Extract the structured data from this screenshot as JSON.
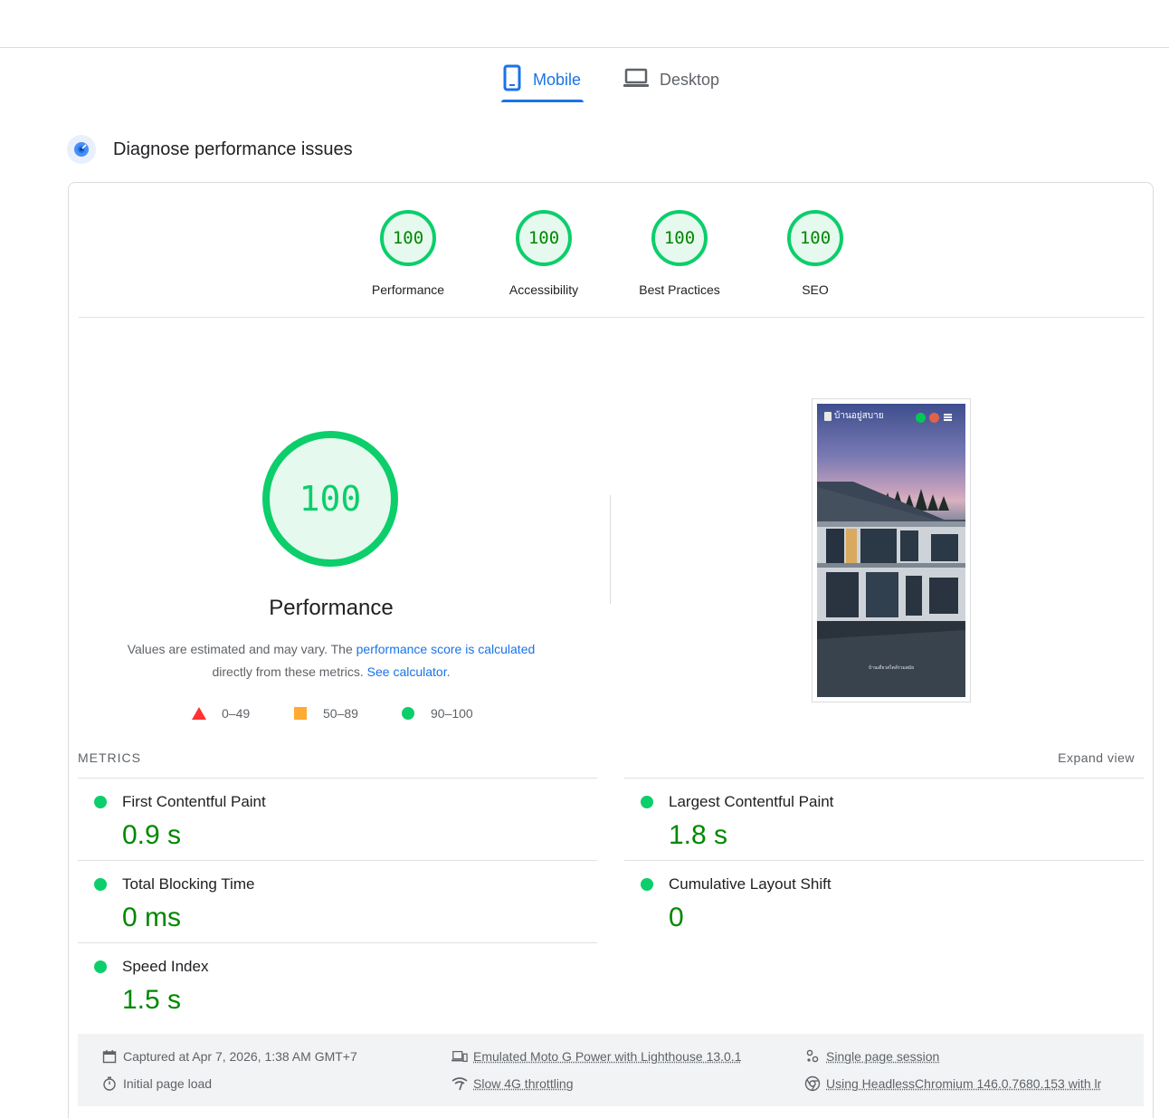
{
  "tabs": {
    "mobile": "Mobile",
    "desktop": "Desktop"
  },
  "section": {
    "title": "Diagnose performance issues"
  },
  "categories": [
    {
      "score": "100",
      "label": "Performance"
    },
    {
      "score": "100",
      "label": "Accessibility"
    },
    {
      "score": "100",
      "label": "Best Practices"
    },
    {
      "score": "100",
      "label": "SEO"
    }
  ],
  "performance": {
    "score": "100",
    "title": "Performance",
    "note_pre": "Values are estimated and may vary. The ",
    "note_link": "performance score is calculated",
    "note_mid": "directly from these metrics. ",
    "note_link2": "See calculator",
    "note_end": "."
  },
  "legend": [
    {
      "range": "0–49",
      "color": "#ff3333"
    },
    {
      "range": "50–89",
      "color": "#ffaa33"
    },
    {
      "range": "90–100",
      "color": "#0cce6b"
    }
  ],
  "screenshot": {
    "site_name": "บ้านอยู่สบาย",
    "caption": "บ้านเดี่ยวสไตล์ร่วมสมัย"
  },
  "metrics": {
    "header": "METRICS",
    "expand": "Expand view",
    "items": [
      {
        "label": "First Contentful Paint",
        "value": "0.9 s"
      },
      {
        "label": "Largest Contentful Paint",
        "value": "1.8 s"
      },
      {
        "label": "Total Blocking Time",
        "value": "0 ms"
      },
      {
        "label": "Cumulative Layout Shift",
        "value": "0"
      },
      {
        "label": "Speed Index",
        "value": "1.5 s"
      }
    ]
  },
  "footer": {
    "captured": "Captured at Apr 7, 2026, 1:38 AM GMT+7",
    "load": "Initial page load",
    "device": "Emulated Moto G Power with Lighthouse 13.0.1",
    "throttling": "Slow 4G throttling",
    "session": "Single page session",
    "browser": "Using HeadlessChromium 146.0.7680.153 with lr"
  },
  "colors": {
    "pass": "#0cce6b",
    "pass_text": "#008800",
    "accent": "#1a73e8"
  }
}
